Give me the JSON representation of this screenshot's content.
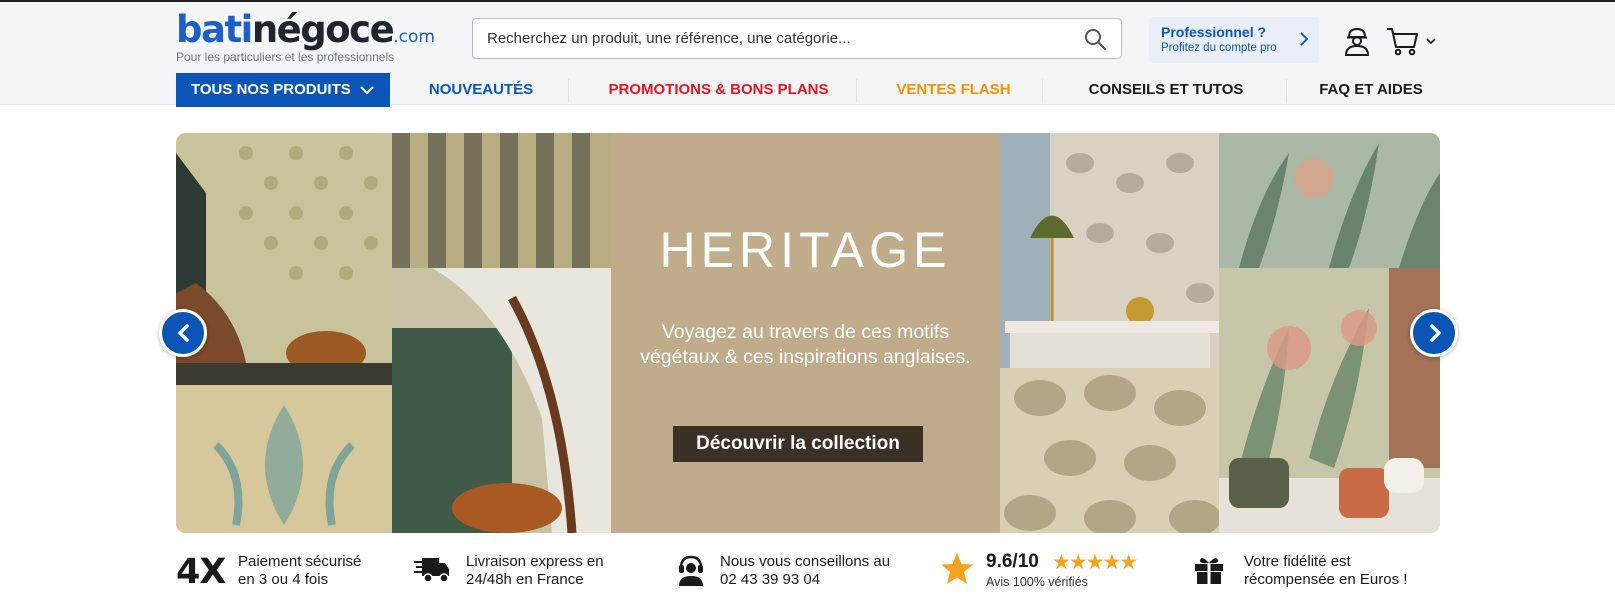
{
  "logo": {
    "part1": "bati",
    "part2": "négoce",
    "suffix": ".com",
    "tagline": "Pour les particuliers et les professionnels"
  },
  "search": {
    "placeholder": "Recherchez un produit, une référence, une catégorie..."
  },
  "pro_box": {
    "title": "Professionnel ?",
    "subtitle": "Profitez du compte pro"
  },
  "nav": {
    "all_products": "TOUS NOS PRODUITS",
    "items": [
      {
        "label": "NOUVEAUTÉS",
        "color": "#0b55b7"
      },
      {
        "label": "PROMOTIONS & BONS PLANS",
        "color": "#e8141e"
      },
      {
        "label": "VENTES FLASH",
        "color": "#f39200"
      },
      {
        "label": "CONSEILS ET TUTOS",
        "color": "#1a1a1a"
      },
      {
        "label": "FAQ ET AIDES",
        "color": "#1a1a1a"
      }
    ]
  },
  "hero": {
    "title": "HERITAGE",
    "subtitle_line1": "Voyagez au travers de ces motifs",
    "subtitle_line2": "végétaux & ces inspirations anglaises.",
    "cta": "Découvrir la collection"
  },
  "reassurance": {
    "payment": {
      "big": "4X",
      "line1": "Paiement sécurisé",
      "line2": "en 3 ou 4 fois"
    },
    "delivery": {
      "icon": "truck-icon",
      "line1": "Livraison express en",
      "line2": "24/48h en France"
    },
    "advice": {
      "icon": "headset-icon",
      "line1": "Nous vous conseillons au",
      "line2": "02 43 39 93 04"
    },
    "rating": {
      "icon": "star-icon",
      "score": "9.6/10",
      "stars": "★★★★★",
      "verified": "Avis 100% vérifiés"
    },
    "loyalty": {
      "icon": "gift-icon",
      "line1": "Votre fidélité est",
      "line2": "récompensée en Euros !"
    }
  },
  "colors": {
    "brand_blue": "#0b55b7",
    "promo_red": "#e8141e",
    "flash_orange": "#f39200",
    "star_orange": "#f5a31a"
  }
}
